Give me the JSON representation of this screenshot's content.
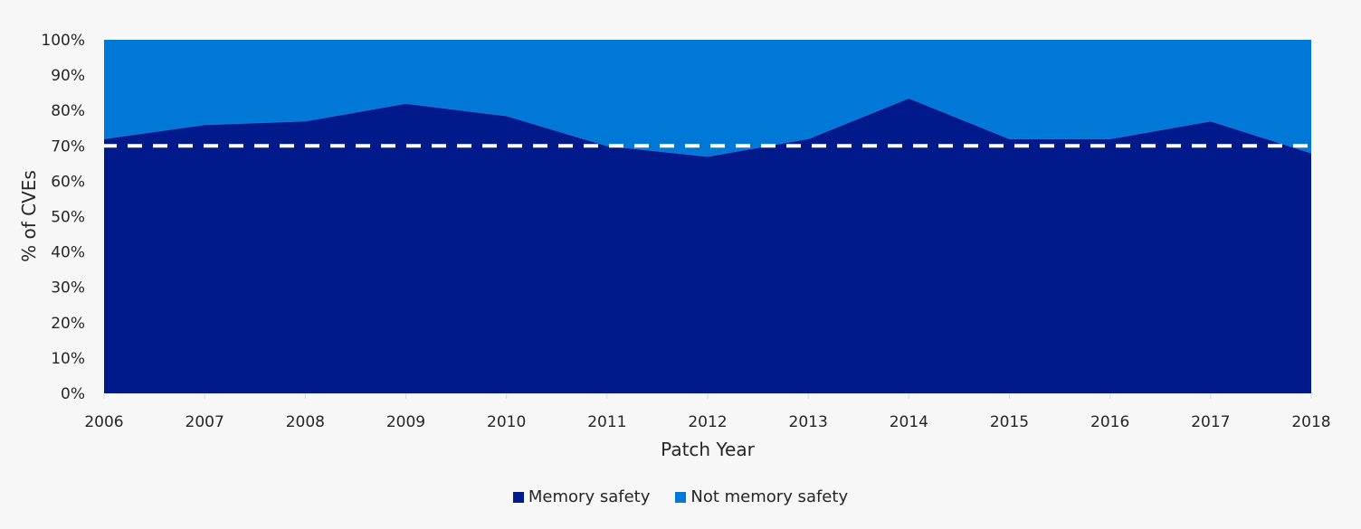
{
  "chart_data": {
    "type": "area",
    "stacked": true,
    "percent_stacked": true,
    "title": "",
    "xlabel": "Patch Year",
    "ylabel": "%  of CVEs",
    "x": [
      2006,
      2007,
      2008,
      2009,
      2010,
      2011,
      2012,
      2013,
      2014,
      2015,
      2016,
      2017,
      2018
    ],
    "x_tick_labels": [
      "2006",
      "2007",
      "2008",
      "2009",
      "2010",
      "2011",
      "2012",
      "2013",
      "2014",
      "2015",
      "2016",
      "2017",
      "2018"
    ],
    "y_tick_labels": [
      "0%",
      "10%",
      "20%",
      "30%",
      "40%",
      "50%",
      "60%",
      "70%",
      "80%",
      "90%",
      "100%"
    ],
    "y_ticks": [
      0,
      10,
      20,
      30,
      40,
      50,
      60,
      70,
      80,
      90,
      100
    ],
    "ylim": [
      0,
      100
    ],
    "grid": false,
    "series": [
      {
        "name": "Memory safety",
        "color": "#001a8c",
        "values": [
          72,
          76,
          77,
          82,
          78.5,
          70,
          67,
          72,
          83.5,
          72,
          72,
          77,
          68
        ]
      },
      {
        "name": "Not memory safety",
        "color": "#0078d7",
        "values": [
          28,
          24,
          23,
          18,
          21.5,
          30,
          33,
          28,
          16.5,
          28,
          28,
          23,
          32
        ]
      }
    ],
    "reference_line": {
      "value": 70,
      "style": "dashed",
      "color": "#ffffff"
    },
    "legend": {
      "position": "bottom-center",
      "entries": [
        "Memory safety",
        "Not memory safety"
      ]
    }
  }
}
